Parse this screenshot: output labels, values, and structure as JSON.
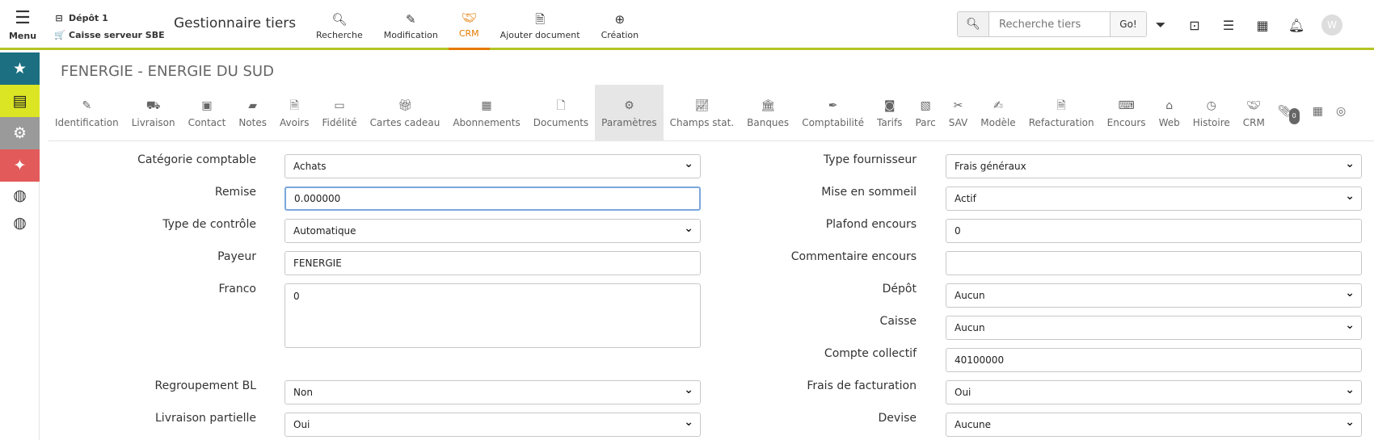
{
  "header": {
    "menu_label": "Menu",
    "depot_label": "Dépôt 1",
    "caisse_label": "Caisse serveur SBE",
    "app_title": "Gestionnaire tiers",
    "nav": [
      {
        "label": "Recherche",
        "icon": "search-icon"
      },
      {
        "label": "Modification",
        "icon": "pencil-icon"
      },
      {
        "label": "CRM",
        "icon": "handshake-icon"
      },
      {
        "label": "Ajouter document",
        "icon": "document-icon"
      },
      {
        "label": "Création",
        "icon": "plus-circle-icon"
      }
    ],
    "active_nav": "CRM",
    "search_placeholder": "Recherche tiers",
    "go_label": "Go!",
    "accent_color": "#e57a00",
    "bar_color": "#b5c424",
    "avatar_letter": "W"
  },
  "page": {
    "title": "FENERGIE - ENERGIE DU SUD"
  },
  "tabs": [
    {
      "label": "Identification",
      "icon": "pencil-icon"
    },
    {
      "label": "Livraison",
      "icon": "truck-icon"
    },
    {
      "label": "Contact",
      "icon": "contact-card-icon"
    },
    {
      "label": "Notes",
      "icon": "note-icon"
    },
    {
      "label": "Avoirs",
      "icon": "invoice-icon"
    },
    {
      "label": "Fidélité",
      "icon": "id-card-icon"
    },
    {
      "label": "Cartes cadeau",
      "icon": "gift-icon"
    },
    {
      "label": "Abonnements",
      "icon": "calendar-plus-icon"
    },
    {
      "label": "Documents",
      "icon": "file-icon"
    },
    {
      "label": "Paramètres",
      "icon": "gear-icon"
    },
    {
      "label": "Champs stat.",
      "icon": "chart-line-icon"
    },
    {
      "label": "Banques",
      "icon": "bank-icon"
    },
    {
      "label": "Comptabilité",
      "icon": "pen-icon"
    },
    {
      "label": "Tarifs",
      "icon": "money-icon"
    },
    {
      "label": "Parc",
      "icon": "picture-icon"
    },
    {
      "label": "SAV",
      "icon": "tools-icon"
    },
    {
      "label": "Modèle",
      "icon": "file-edit-icon"
    },
    {
      "label": "Refacturation",
      "icon": "document-icon"
    },
    {
      "label": "Encours",
      "icon": "cash-register-icon"
    },
    {
      "label": "Web",
      "icon": "store-icon"
    },
    {
      "label": "Histoire",
      "icon": "clock-icon"
    },
    {
      "label": "CRM",
      "icon": "handshake-icon"
    },
    {
      "label": "",
      "icon": "paperclip-icon",
      "badge": "0"
    },
    {
      "label": "",
      "icon": "calendar-icon"
    },
    {
      "label": "",
      "icon": "fingerprint-icon"
    }
  ],
  "active_tab": "Paramètres",
  "form_left": [
    {
      "label": "Catégorie comptable",
      "value": "Achats",
      "type": "select"
    },
    {
      "label": "Remise",
      "value": "0.000000",
      "type": "input",
      "focus": true
    },
    {
      "label": "Type de contrôle",
      "value": "Automatique",
      "type": "select"
    },
    {
      "label": "Payeur",
      "value": "FENERGIE",
      "type": "input"
    },
    {
      "label": "Franco",
      "value": "0",
      "type": "textarea"
    },
    {
      "label": "Regroupement BL",
      "value": "Non",
      "type": "select"
    },
    {
      "label": "Livraison partielle",
      "value": "Oui",
      "type": "select"
    }
  ],
  "form_right": [
    {
      "label": "Type fournisseur",
      "value": "Frais généraux",
      "type": "select"
    },
    {
      "label": "Mise en sommeil",
      "value": "Actif",
      "type": "select"
    },
    {
      "label": "Plafond encours",
      "value": "0",
      "type": "input"
    },
    {
      "label": "Commentaire encours",
      "value": "",
      "type": "input"
    },
    {
      "label": "Dépôt",
      "value": "Aucun",
      "type": "select"
    },
    {
      "label": "Caisse",
      "value": "Aucun",
      "type": "select"
    },
    {
      "label": "Compte collectif",
      "value": "40100000",
      "type": "input"
    },
    {
      "label": "Frais de facturation",
      "value": "Oui",
      "type": "select"
    },
    {
      "label": "Devise",
      "value": "Aucune",
      "type": "select"
    }
  ]
}
